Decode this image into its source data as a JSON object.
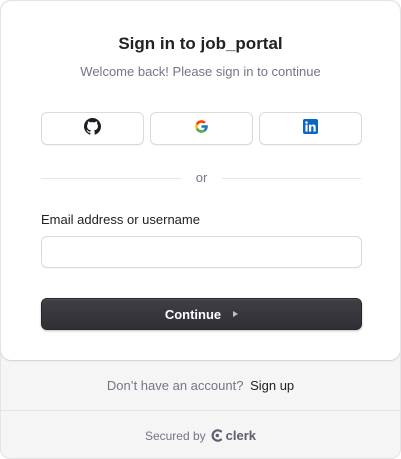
{
  "header": {
    "title": "Sign in to job_portal",
    "subtitle": "Welcome back! Please sign in to continue"
  },
  "social": [
    {
      "provider": "github-icon"
    },
    {
      "provider": "google-icon"
    },
    {
      "provider": "linkedin-icon"
    }
  ],
  "divider": {
    "text": "or"
  },
  "form": {
    "identifier_label": "Email address or username",
    "identifier_value": "",
    "identifier_placeholder": "",
    "continue_label": "Continue"
  },
  "footer": {
    "signup_prompt": "Don’t have an account?",
    "signup_link": "Sign up",
    "secured_by": "Secured by",
    "brand": "clerk"
  },
  "colors": {
    "primary_button": "#2f2f35",
    "text": "#212126",
    "muted": "#747686",
    "google_blue": "#4285F4",
    "linkedin_blue": "#0A66C2"
  }
}
